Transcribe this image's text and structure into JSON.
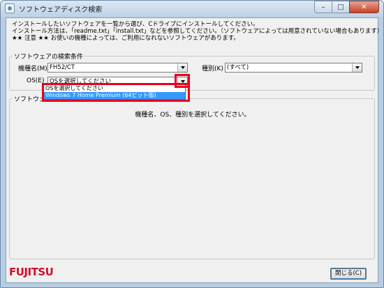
{
  "window": {
    "title": "ソフトウェアディスク検索"
  },
  "caption": {
    "minimize": "–",
    "maximize": "□",
    "close": "✕"
  },
  "intro": {
    "line1": "インストールしたいソフトウェアを一覧から選び、Cドライブにインストールしてください。",
    "line2": "インストール方法は、「readme.txt」「install.txt」などを参照してください。（ソフトウェアによっては用意されていない場合もあります）",
    "line3": "★★ 注意 ★★ お使いの機種によっては、ご利用になれないソフトウェアがあります。"
  },
  "search": {
    "legend": "ソフトウェアの検索条件",
    "model_label": "機種名(M)",
    "model_value": "FH52/CT",
    "type_label": "種別(K)",
    "type_value": "(すべて)",
    "os_label": "OS(E)",
    "os_value": "OSを選択してください"
  },
  "os_dropdown": {
    "options": [
      "OSを選択してください",
      "Windows 7 Home Premium (64ビット版)"
    ],
    "selected_index": 1
  },
  "software": {
    "legend": "ソフトウェア一覧",
    "message": "機種名、OS、種別を選択してください。"
  },
  "footer": {
    "logo": "FUJITSU",
    "close_button": "閉じる(C)"
  },
  "colors": {
    "highlight": "#e8001c",
    "selection": "#3399ff",
    "logo": "#d0102a"
  }
}
